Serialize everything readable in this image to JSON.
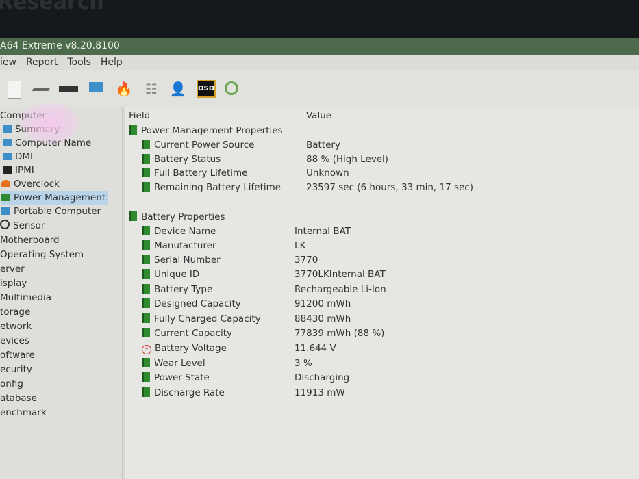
{
  "background_text": "Research",
  "title": "A64 Extreme v8.20.8100",
  "menu": [
    "iew",
    "Report",
    "Tools",
    "Help"
  ],
  "toolbar_icons": [
    "report-icon",
    "disk-icon",
    "memory-icon",
    "computer-icon",
    "flame-icon",
    "network-icon",
    "user-icon",
    "osd-icon",
    "gauge-icon"
  ],
  "osd_label": "OSD",
  "sidebar": {
    "root": "Computer",
    "children": [
      "Summary",
      "Computer Name",
      "DMI",
      "IPMI",
      "Overclock",
      "Power Management",
      "Portable Computer",
      "Sensor"
    ],
    "selected": "Power Management",
    "categories": [
      "Motherboard",
      "Operating System",
      "erver",
      "isplay",
      "Multimedia",
      "torage",
      "etwork",
      "evices",
      "oftware",
      "ecurity",
      "onfig",
      "atabase",
      "enchmark"
    ]
  },
  "table": {
    "headers": {
      "field": "Field",
      "value": "Value"
    },
    "groups": [
      {
        "title": "Power Management Properties",
        "rows": [
          {
            "field": "Current Power Source",
            "value": "Battery"
          },
          {
            "field": "Battery Status",
            "value": "88 % (High Level)"
          },
          {
            "field": "Full Battery Lifetime",
            "value": "Unknown"
          },
          {
            "field": "Remaining Battery Lifetime",
            "value": "23597 sec (6 hours, 33 min, 17 sec)"
          }
        ]
      },
      {
        "title": "Battery Properties",
        "rows": [
          {
            "field": "Device Name",
            "value": "Internal BAT"
          },
          {
            "field": "Manufacturer",
            "value": "LK"
          },
          {
            "field": "Serial Number",
            "value": "3770"
          },
          {
            "field": "Unique ID",
            "value": "3770LKInternal BAT"
          },
          {
            "field": "Battery Type",
            "value": "Rechargeable Li-Ion"
          },
          {
            "field": "Designed Capacity",
            "value": "91200 mWh"
          },
          {
            "field": "Fully Charged Capacity",
            "value": "88430 mWh"
          },
          {
            "field": "Current Capacity",
            "value": "77839 mWh  (88 %)"
          },
          {
            "field": "Battery Voltage",
            "value": "11.644 V"
          },
          {
            "field": "Wear Level",
            "value": "3 %"
          },
          {
            "field": "Power State",
            "value": "Discharging"
          },
          {
            "field": "Discharge Rate",
            "value": "11913 mW"
          }
        ]
      }
    ]
  }
}
